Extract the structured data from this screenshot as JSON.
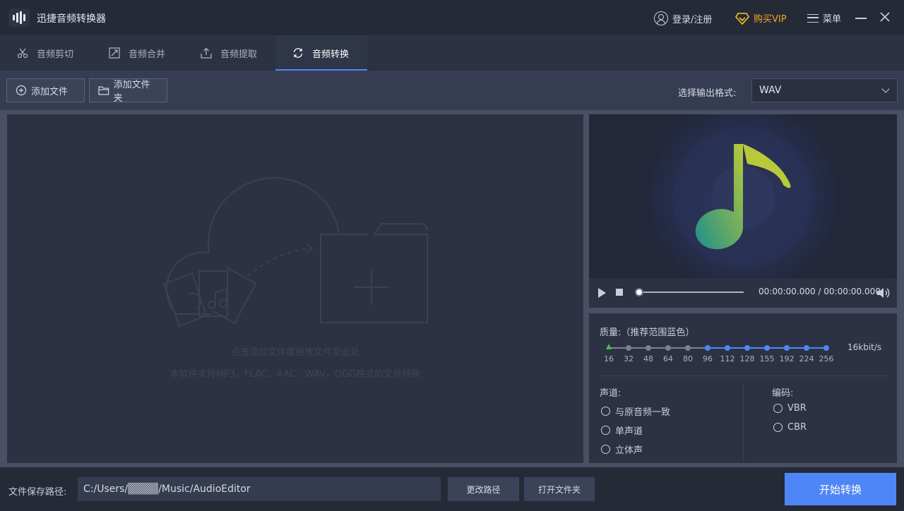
{
  "app": {
    "title": "迅捷音频转换器"
  },
  "titlebar": {
    "login_label": "登录/注册",
    "vip_label": "购买VIP",
    "menu_label": "菜单"
  },
  "tabs": [
    {
      "label": "音频剪切",
      "icon": "scissors-icon"
    },
    {
      "label": "音频合并",
      "icon": "merge-icon"
    },
    {
      "label": "音频提取",
      "icon": "extract-icon"
    },
    {
      "label": "音频转换",
      "icon": "convert-icon",
      "active": true
    }
  ],
  "toolbar": {
    "add_file_label": "添加文件",
    "add_folder_label": "添加文件夹",
    "format_label": "选择输出格式:",
    "format_value": "WAV"
  },
  "dropzone": {
    "hint": "点击添加文件或拖拽文件至此处",
    "support": "本软件支持MP3，FLAC，AAC，WAV，OGG格式的文件转换"
  },
  "player": {
    "time": "00:00:00.000 / 00:00:00.000",
    "progress": 0
  },
  "quality": {
    "label": "质量:（推荐范围蓝色）",
    "ticks": [
      "16",
      "32",
      "48",
      "64",
      "80",
      "96",
      "112",
      "128",
      "155",
      "192",
      "224",
      "256"
    ],
    "current": "16kbit/s",
    "colors": {
      "recommended": "#4f86f7",
      "normal": "#7b8193",
      "selected": "#3cc43c"
    }
  },
  "channel": {
    "label": "声道:",
    "options": [
      "与原音频一致",
      "单声道",
      "立体声"
    ]
  },
  "encoding": {
    "label": "编码:",
    "options": [
      "VBR",
      "CBR"
    ]
  },
  "bottom": {
    "path_label": "文件保存路径:",
    "path_value": "C:/Users/▒▒▒▒/Music/AudioEditor",
    "change_path_label": "更改路径",
    "open_folder_label": "打开文件夹",
    "start_label": "开始转换"
  }
}
